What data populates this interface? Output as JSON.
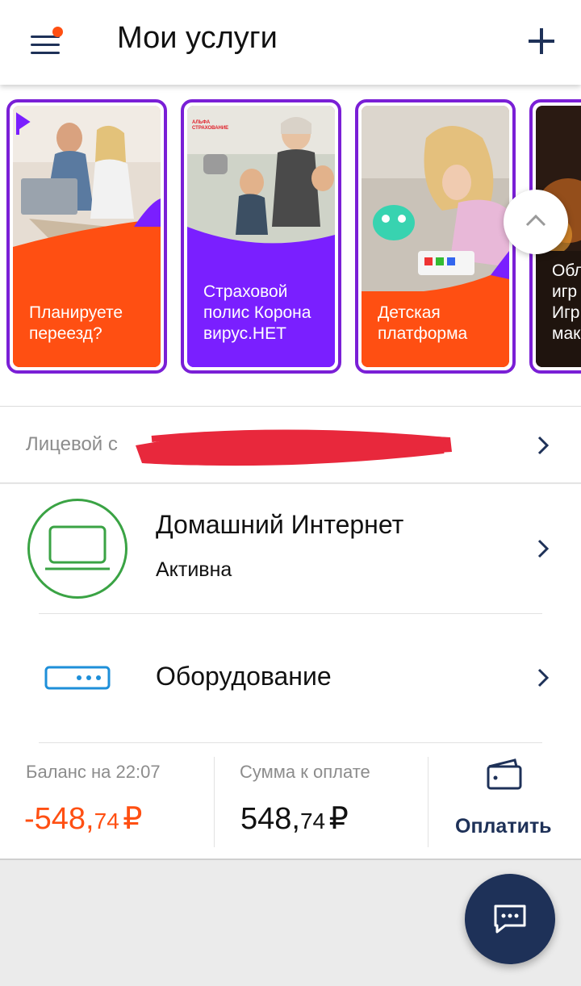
{
  "header": {
    "title": "Мои услуги"
  },
  "stories": [
    {
      "caption_line1": "Планируете",
      "caption_line2": "переезд?",
      "caption_line3": "",
      "bg_color": "#ff4f12"
    },
    {
      "caption_line1": "Страховой",
      "caption_line2": "полис Корона",
      "caption_line3": "вирус.НЕТ",
      "bg_color": "#7a1fff",
      "brand": "АЛЬФА СТРАХОВАНИЕ"
    },
    {
      "caption_line1": "Детская",
      "caption_line2": "платформа",
      "caption_line3": "",
      "bg_color": "#ff4f12"
    },
    {
      "caption_line1": "Обл",
      "caption_line2": "игр",
      "caption_line3": "Игр",
      "caption_line4": "мак"
    }
  ],
  "account": {
    "label": "Лицевой с"
  },
  "services": [
    {
      "title": "Домашний Интернет",
      "status": "Активна",
      "icon": "laptop-icon"
    },
    {
      "title": "Оборудование",
      "icon": "router-icon"
    }
  ],
  "balance": {
    "label": "Баланс на 22:07",
    "amount_int": "-548,",
    "amount_frac": "74",
    "currency": "₽",
    "color": "#ff4f12"
  },
  "due": {
    "label": "Сумма к оплате",
    "amount_int": "548,",
    "amount_frac": "74",
    "currency": "₽"
  },
  "pay": {
    "label": "Оплатить"
  },
  "colors": {
    "accent": "#ff4f12",
    "navy": "#1e3158",
    "purple": "#7a1fd6",
    "green": "#3aa344",
    "blue": "#1e8fd9"
  }
}
